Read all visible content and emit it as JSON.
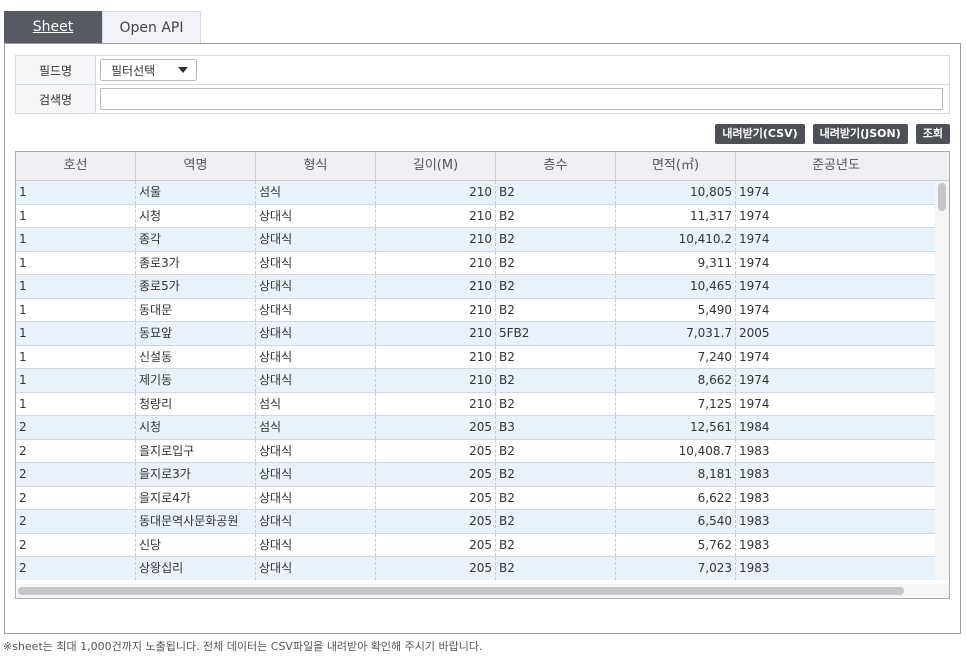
{
  "tabs": [
    {
      "label": "Sheet"
    },
    {
      "label": "Open API"
    }
  ],
  "filter": {
    "field_label": "필드명",
    "field_select_value": "필터선택",
    "search_label": "검색명",
    "search_value": ""
  },
  "buttons": {
    "csv": "내려받기(CSV)",
    "json": "내려받기(JSON)",
    "query": "조회"
  },
  "table": {
    "columns": [
      "호선",
      "역명",
      "형식",
      "길이(M)",
      "층수",
      "면적(㎡)",
      "준공년도"
    ],
    "rows": [
      [
        "1",
        "서울",
        "섬식",
        "210",
        "B2",
        "10,805",
        "1974"
      ],
      [
        "1",
        "시청",
        "상대식",
        "210",
        "B2",
        "11,317",
        "1974"
      ],
      [
        "1",
        "종각",
        "상대식",
        "210",
        "B2",
        "10,410.2",
        "1974"
      ],
      [
        "1",
        "종로3가",
        "상대식",
        "210",
        "B2",
        "9,311",
        "1974"
      ],
      [
        "1",
        "종로5가",
        "상대식",
        "210",
        "B2",
        "10,465",
        "1974"
      ],
      [
        "1",
        "동대문",
        "상대식",
        "210",
        "B2",
        "5,490",
        "1974"
      ],
      [
        "1",
        "동묘앞",
        "상대식",
        "210",
        "5FB2",
        "7,031.7",
        "2005"
      ],
      [
        "1",
        "신설동",
        "상대식",
        "210",
        "B2",
        "7,240",
        "1974"
      ],
      [
        "1",
        "제기동",
        "상대식",
        "210",
        "B2",
        "8,662",
        "1974"
      ],
      [
        "1",
        "청량리",
        "섬식",
        "210",
        "B2",
        "7,125",
        "1974"
      ],
      [
        "2",
        "시청",
        "섬식",
        "205",
        "B3",
        "12,561",
        "1984"
      ],
      [
        "2",
        "을지로입구",
        "상대식",
        "205",
        "B2",
        "10,408.7",
        "1983"
      ],
      [
        "2",
        "을지로3가",
        "상대식",
        "205",
        "B2",
        "8,181",
        "1983"
      ],
      [
        "2",
        "을지로4가",
        "상대식",
        "205",
        "B2",
        "6,622",
        "1983"
      ],
      [
        "2",
        "동대문역사문화공원",
        "상대식",
        "205",
        "B2",
        "6,540",
        "1983"
      ],
      [
        "2",
        "신당",
        "상대식",
        "205",
        "B2",
        "5,762",
        "1983"
      ],
      [
        "2",
        "상왕십리",
        "상대식",
        "205",
        "B2",
        "7,023",
        "1983"
      ]
    ]
  },
  "footnote": "※sheet는 최대 1,000건까지 노출됩니다. 전체 데이터는 CSV파일을 내려받아 확인해 주시기 바랍니다."
}
